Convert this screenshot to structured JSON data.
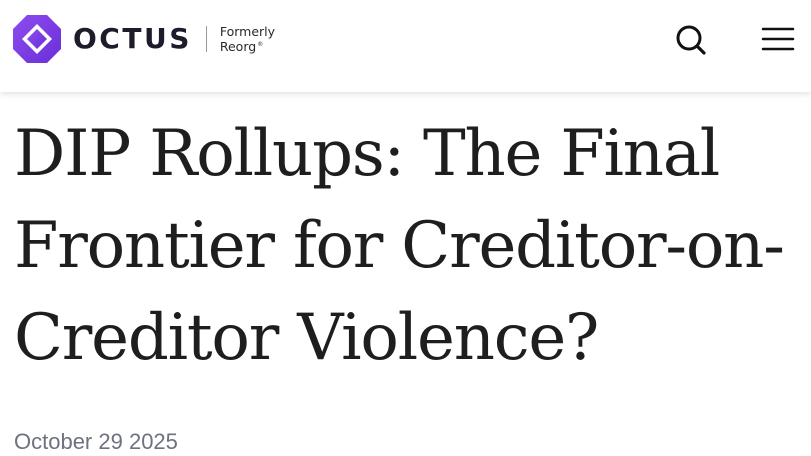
{
  "header": {
    "logo": {
      "wordmark": "OCTUS",
      "formerly_line1": "Formerly",
      "formerly_line2": "Reorg",
      "trademark": "®",
      "brand_color": "#7b3fe4"
    },
    "search_icon": "search-icon",
    "menu_icon": "hamburger-menu-icon"
  },
  "article": {
    "title": "DIP Rollups: The Final Frontier for Creditor-on-Creditor Violence?",
    "date": "October 29 2025"
  },
  "colors": {
    "brand_purple": "#7b3fe4",
    "text_dark": "#1e1e1e",
    "date_gray": "#6e7180"
  }
}
